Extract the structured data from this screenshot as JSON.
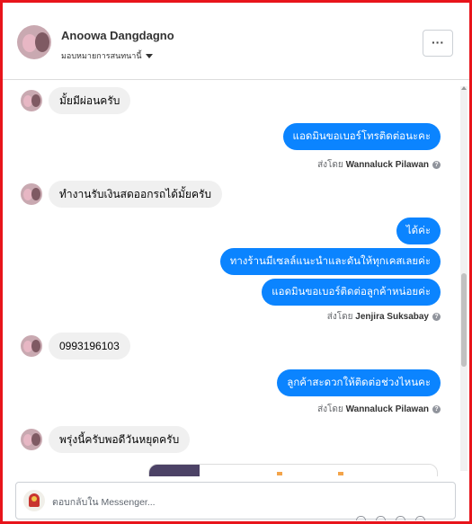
{
  "header": {
    "name": "Anoowa Dangdagno",
    "status": "มอบหมายการสนทนานี้",
    "more_label": "···"
  },
  "messages": [
    {
      "direction": "in",
      "text": "มั้ยมีผ่อนครับ"
    },
    {
      "direction": "out",
      "texts": [
        "แอดมินขอเบอร์โทรติดต่อนะคะ"
      ],
      "sent_by_label": "ส่งโดย",
      "sender": "Wannaluck Pilawan"
    },
    {
      "direction": "in",
      "text": "ทำงานรับเงินสดออกรถได้มั้ยครับ"
    },
    {
      "direction": "out",
      "texts": [
        "ได้ค่ะ",
        "ทางร้านมีเซลล์แนะนำและดันให้ทุกเคสเลยค่ะ",
        "แอดมินขอเบอร์ติดต่อลูกค้าหน่อยค่ะ"
      ],
      "sent_by_label": "ส่งโดย",
      "sender": "Jenjira Suksabay"
    },
    {
      "direction": "in",
      "text": "0993196103"
    },
    {
      "direction": "out",
      "texts": [
        "ลูกค้าสะดวกให้ติดต่อช่วงไหนคะ"
      ],
      "sent_by_label": "ส่งโดย",
      "sender": "Wannaluck Pilawan"
    },
    {
      "direction": "in",
      "text": "พรุ่งนี้ครับพอดีวันหยุดครับ"
    }
  ],
  "composer": {
    "placeholder": "ตอบกลับใน Messenger..."
  },
  "colors": {
    "frame": "#e8141b",
    "outgoing_bubble": "#0b84ff",
    "incoming_bubble": "#f0f0f0"
  },
  "icons": [
    "more-icon",
    "caret-down-icon",
    "info-icon"
  ]
}
